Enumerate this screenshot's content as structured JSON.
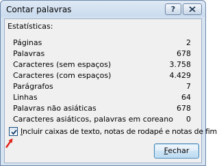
{
  "window": {
    "title": "Contar palavras",
    "help_glyph": "?",
    "close_icon": "close-icon"
  },
  "section_label": "Estatísticas:",
  "stats": [
    {
      "label": "Páginas",
      "value": "2"
    },
    {
      "label": "Palavras",
      "value": "678"
    },
    {
      "label": "Caracteres (sem espaços)",
      "value": "3.758"
    },
    {
      "label": "Caracteres (com espaços)",
      "value": "4.429"
    },
    {
      "label": "Parágrafos",
      "value": "7"
    },
    {
      "label": "Linhas",
      "value": "64"
    },
    {
      "label": "Palavras não asiáticas",
      "value": "678"
    },
    {
      "label": "Caracteres asiáticos, palavras em coreano",
      "value": "0"
    }
  ],
  "checkbox": {
    "checked": true,
    "label_accel": "I",
    "label_rest": "ncluir caixas de texto, notas de rodapé e notas de fim"
  },
  "annotation": {
    "icon": "red-arrow-icon",
    "color": "#e0201a"
  },
  "buttons": {
    "close_accel": "F",
    "close_rest": "echar"
  }
}
